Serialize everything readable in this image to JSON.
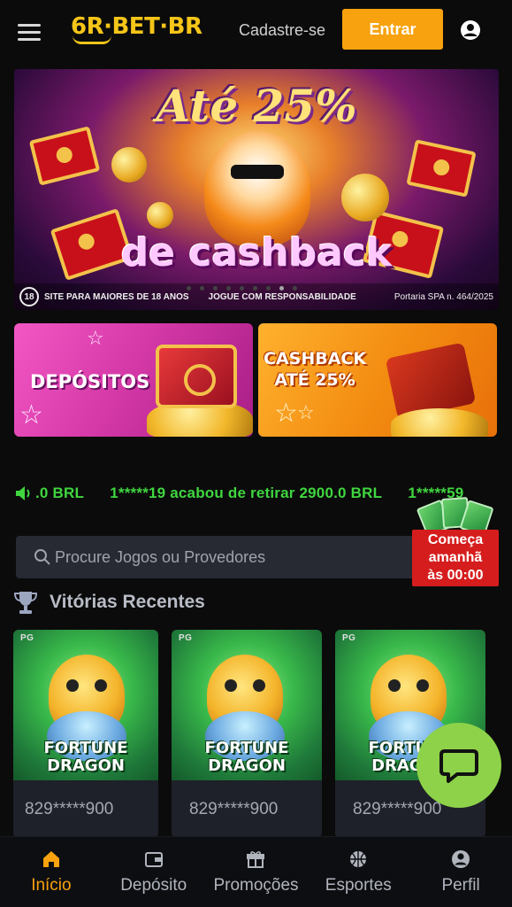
{
  "header": {
    "logo_text": "6R·BET·BR",
    "signup_label": "Cadastre-se",
    "login_label": "Entrar"
  },
  "hero": {
    "title_top": "Até 25%",
    "title_bottom": "de cashback",
    "age_badge": "18",
    "age_notice": "SITE PARA MAIORES DE 18 ANOS",
    "responsible_notice": "JOGUE COM RESPONSABILIDADE",
    "ordinance": "Portaria SPA n. 464/2025",
    "slide_count": 9,
    "active_slide": 7
  },
  "promos": {
    "deposit_label": "DEPÓSITOS",
    "cashback_label_line1": "CASHBACK",
    "cashback_label_line2": "ATÉ 25%"
  },
  "ticker": {
    "text": ".0 BRL      1*****19 acabou de retirar 2900.0 BRL      1*****59"
  },
  "countdown": {
    "line1": "Começa",
    "line2": "amanhã",
    "line3": "às 00:00"
  },
  "search": {
    "placeholder": "Procure Jogos ou Provedores"
  },
  "recent_wins": {
    "title": "Vitórias Recentes",
    "items": [
      {
        "provider": "PG",
        "game_line1": "FORTUNE",
        "game_line2": "DRAGON",
        "user": "829*****900"
      },
      {
        "provider": "PG",
        "game_line1": "FORTUNE",
        "game_line2": "DRAGON",
        "user": "829*****900"
      },
      {
        "provider": "PG",
        "game_line1": "FORTUNE",
        "game_line2": "DRAGON",
        "user": "829*****900"
      }
    ]
  },
  "bottom_nav": {
    "items": [
      {
        "label": "Início",
        "icon": "home-icon",
        "active": true
      },
      {
        "label": "Depósito",
        "icon": "wallet-icon",
        "active": false
      },
      {
        "label": "Promoções",
        "icon": "gift-icon",
        "active": false
      },
      {
        "label": "Esportes",
        "icon": "basketball-icon",
        "active": false
      },
      {
        "label": "Perfil",
        "icon": "profile-icon",
        "active": false
      }
    ]
  },
  "colors": {
    "accent": "#f7a20e",
    "ticker_green": "#3fd63f",
    "chat_green": "#8ed24a",
    "countdown_red": "#d61d1d",
    "background": "#0b0b0b"
  }
}
